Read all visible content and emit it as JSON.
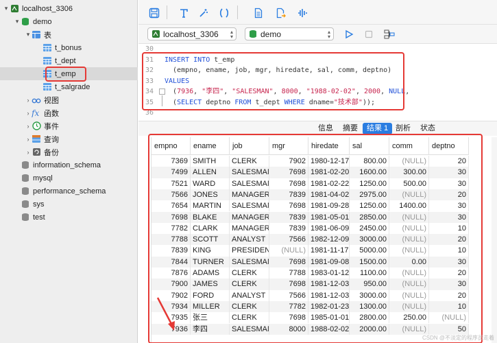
{
  "sidebar": {
    "items": [
      {
        "label": "localhost_3306",
        "icon": "server-icon",
        "chev": "▾",
        "indent": 4
      },
      {
        "label": "demo",
        "icon": "database-icon",
        "chev": "▾",
        "indent": 20
      },
      {
        "label": "表",
        "icon": "tables-folder-icon",
        "chev": "▾",
        "indent": 36
      },
      {
        "label": "t_bonus",
        "icon": "table-icon",
        "chev": "",
        "indent": 52
      },
      {
        "label": "t_dept",
        "icon": "table-icon",
        "chev": "",
        "indent": 52
      },
      {
        "label": "t_emp",
        "icon": "table-icon",
        "chev": "",
        "indent": 52
      },
      {
        "label": "t_salgrade",
        "icon": "table-icon",
        "chev": "",
        "indent": 52
      },
      {
        "label": "视图",
        "icon": "view-icon",
        "chev": "›",
        "indent": 36
      },
      {
        "label": "函数",
        "icon": "function-icon",
        "chev": "›",
        "indent": 36
      },
      {
        "label": "事件",
        "icon": "event-icon",
        "chev": "›",
        "indent": 36
      },
      {
        "label": "查询",
        "icon": "query-icon",
        "chev": "›",
        "indent": 36
      },
      {
        "label": "备份",
        "icon": "backup-icon",
        "chev": "›",
        "indent": 36
      },
      {
        "label": "information_schema",
        "icon": "database-gray-icon",
        "chev": "",
        "indent": 20
      },
      {
        "label": "mysql",
        "icon": "database-gray-icon",
        "chev": "",
        "indent": 20
      },
      {
        "label": "performance_schema",
        "icon": "database-gray-icon",
        "chev": "",
        "indent": 20
      },
      {
        "label": "sys",
        "icon": "database-gray-icon",
        "chev": "",
        "indent": 20
      },
      {
        "label": "test",
        "icon": "database-gray-icon",
        "chev": "",
        "indent": 20
      }
    ]
  },
  "toolbar": {
    "icons": [
      "save-icon",
      "format-icon",
      "magic-wand-icon",
      "brackets-icon",
      "document-icon",
      "export-icon",
      "explain-icon"
    ]
  },
  "connection": {
    "server": "localhost_3306",
    "database": "demo",
    "icons": [
      "run-icon",
      "stop-icon",
      "schema-icon"
    ]
  },
  "editor": {
    "lines": [
      {
        "no": "30",
        "tokens": []
      },
      {
        "no": "31",
        "tokens": [
          [
            "kw",
            "INSERT INTO"
          ],
          [
            "pl",
            " t_emp"
          ]
        ]
      },
      {
        "no": "32",
        "tokens": [
          [
            "pl",
            "  (empno, ename, job, mgr, hiredate, sal, comm, deptno)"
          ]
        ]
      },
      {
        "no": "33",
        "tokens": [
          [
            "kw",
            "VALUES"
          ]
        ]
      },
      {
        "no": "34",
        "tokens": [
          [
            "pl",
            "  ("
          ],
          [
            "num",
            "7936"
          ],
          [
            "pl",
            ", "
          ],
          [
            "str",
            "\"李四\""
          ],
          [
            "pl",
            ", "
          ],
          [
            "str",
            "\"SALESMAN\""
          ],
          [
            "pl",
            ", "
          ],
          [
            "num",
            "8000"
          ],
          [
            "pl",
            ", "
          ],
          [
            "str",
            "\"1988-02-02\""
          ],
          [
            "pl",
            ", "
          ],
          [
            "num",
            "2000"
          ],
          [
            "pl",
            ", "
          ],
          [
            "kw",
            "NULL"
          ],
          [
            "pl",
            ","
          ]
        ]
      },
      {
        "no": "35",
        "tokens": [
          [
            "pl",
            "  ("
          ],
          [
            "kw",
            "SELECT"
          ],
          [
            "pl",
            " deptno "
          ],
          [
            "kw",
            "FROM"
          ],
          [
            "pl",
            " t_dept "
          ],
          [
            "kw",
            "WHERE"
          ],
          [
            "pl",
            " dname="
          ],
          [
            "str",
            "\"技术部\""
          ],
          [
            "pl",
            "));"
          ]
        ]
      },
      {
        "no": "36",
        "tokens": []
      }
    ]
  },
  "result_tabs": [
    "信息",
    "摘要",
    "结果 1",
    "剖析",
    "状态"
  ],
  "result_tabs_active": 2,
  "grid": {
    "columns": [
      "empno",
      "ename",
      "job",
      "mgr",
      "hiredate",
      "sal",
      "comm",
      "deptno"
    ],
    "rows": [
      [
        "7369",
        "SMITH",
        "CLERK",
        "7902",
        "1980-12-17",
        "800.00",
        "(NULL)",
        "20"
      ],
      [
        "7499",
        "ALLEN",
        "SALESMAN",
        "7698",
        "1981-02-20",
        "1600.00",
        "300.00",
        "30"
      ],
      [
        "7521",
        "WARD",
        "SALESMAN",
        "7698",
        "1981-02-22",
        "1250.00",
        "500.00",
        "30"
      ],
      [
        "7566",
        "JONES",
        "MANAGER",
        "7839",
        "1981-04-02",
        "2975.00",
        "(NULL)",
        "20"
      ],
      [
        "7654",
        "MARTIN",
        "SALESMAN",
        "7698",
        "1981-09-28",
        "1250.00",
        "1400.00",
        "30"
      ],
      [
        "7698",
        "BLAKE",
        "MANAGER",
        "7839",
        "1981-05-01",
        "2850.00",
        "(NULL)",
        "30"
      ],
      [
        "7782",
        "CLARK",
        "MANAGER",
        "7839",
        "1981-06-09",
        "2450.00",
        "(NULL)",
        "10"
      ],
      [
        "7788",
        "SCOTT",
        "ANALYST",
        "7566",
        "1982-12-09",
        "3000.00",
        "(NULL)",
        "20"
      ],
      [
        "7839",
        "KING",
        "PRESIDENT",
        "(NULL)",
        "1981-11-17",
        "5000.00",
        "(NULL)",
        "10"
      ],
      [
        "7844",
        "TURNER",
        "SALESMAN",
        "7698",
        "1981-09-08",
        "1500.00",
        "0.00",
        "30"
      ],
      [
        "7876",
        "ADAMS",
        "CLERK",
        "7788",
        "1983-01-12",
        "1100.00",
        "(NULL)",
        "20"
      ],
      [
        "7900",
        "JAMES",
        "CLERK",
        "7698",
        "1981-12-03",
        "950.00",
        "(NULL)",
        "30"
      ],
      [
        "7902",
        "FORD",
        "ANALYST",
        "7566",
        "1981-12-03",
        "3000.00",
        "(NULL)",
        "20"
      ],
      [
        "7934",
        "MILLER",
        "CLERK",
        "7782",
        "1982-01-23",
        "1300.00",
        "(NULL)",
        "10"
      ],
      [
        "7935",
        "张三",
        "CLERK",
        "7698",
        "1985-01-01",
        "2800.00",
        "250.00",
        "(NULL)"
      ],
      [
        "7936",
        "李四",
        "SALESMAN",
        "8000",
        "1988-02-02",
        "2000.00",
        "(NULL)",
        "50"
      ]
    ]
  },
  "colors": {
    "accent": "#2a7de1",
    "annotation": "#e53935",
    "keyword": "#1f4fd8",
    "string": "#c7254e"
  },
  "watermark": "CSDN @不淡定的程序员走着"
}
